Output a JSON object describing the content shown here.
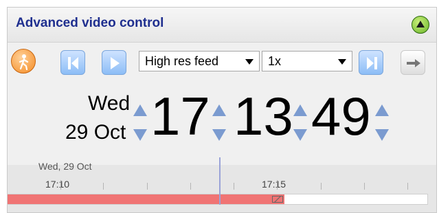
{
  "panel": {
    "title": "Advanced video control"
  },
  "toolbar": {
    "feed_select": {
      "value": "High res feed"
    },
    "speed_select": {
      "value": "1x"
    }
  },
  "clock": {
    "weekday": "Wed",
    "date": "29 Oct",
    "hours": "17",
    "minutes": "13",
    "seconds": "49"
  },
  "timeline": {
    "date_label": "Wed, 29 Oct",
    "tick_labels": [
      "17:10",
      "17:15"
    ],
    "progress_fraction": 0.66
  },
  "colors": {
    "title": "#1f2f8f",
    "progress": "#f07474",
    "accent_blue": "#8cbdf6"
  },
  "icons": {
    "collapse": "collapse-up-icon",
    "person": "walking-person-icon",
    "skip_start": "skip-to-start-icon",
    "play": "play-icon",
    "skip_end": "skip-to-end-icon",
    "arrow": "arrow-right-icon"
  }
}
